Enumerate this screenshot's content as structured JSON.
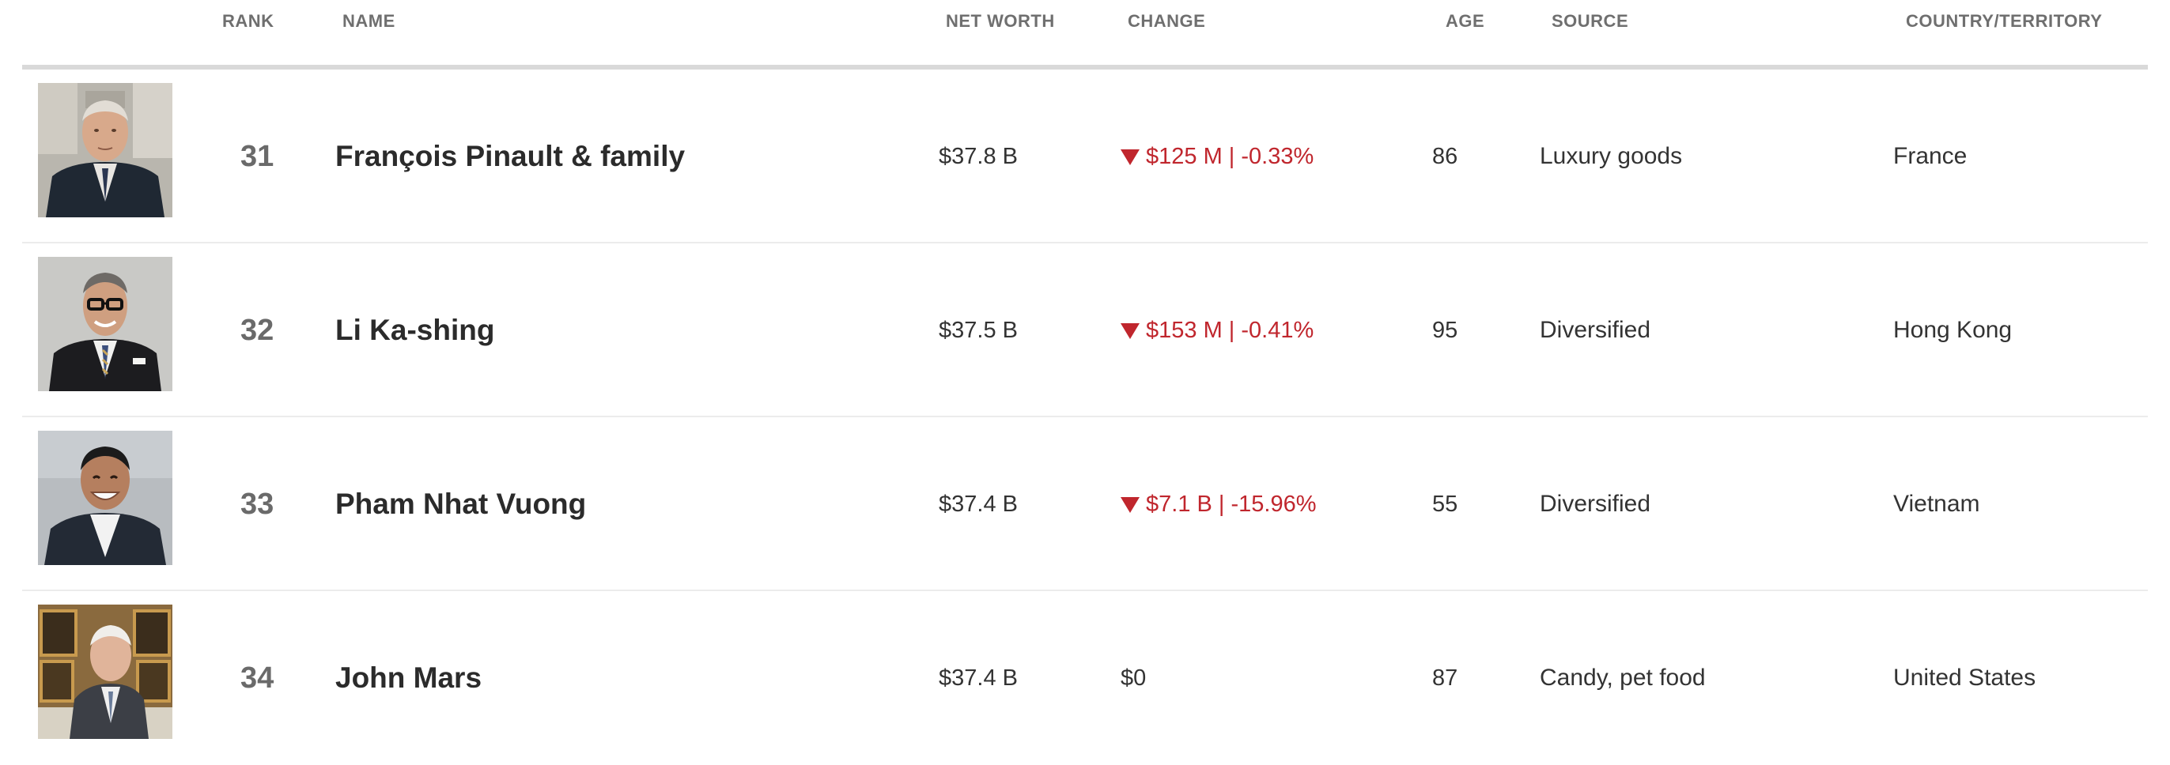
{
  "columns": {
    "rank": "RANK",
    "name": "NAME",
    "net_worth": "NET WORTH",
    "change": "CHANGE",
    "age": "AGE",
    "source": "SOURCE",
    "country": "COUNTRY/TERRITORY"
  },
  "rows": [
    {
      "photo_icon": "person-portrait-photo",
      "rank": "31",
      "name": "François Pinault & family",
      "net_worth": "$37.8 B",
      "change": "$125 M | -0.33%",
      "change_direction": "down",
      "age": "86",
      "source": "Luxury goods",
      "country": "France"
    },
    {
      "photo_icon": "person-portrait-photo",
      "rank": "32",
      "name": "Li Ka-shing",
      "net_worth": "$37.5 B",
      "change": "$153 M | -0.41%",
      "change_direction": "down",
      "age": "95",
      "source": "Diversified",
      "country": "Hong Kong"
    },
    {
      "photo_icon": "person-portrait-photo",
      "rank": "33",
      "name": "Pham Nhat Vuong",
      "net_worth": "$37.4 B",
      "change": "$7.1 B | -15.96%",
      "change_direction": "down",
      "age": "55",
      "source": "Diversified",
      "country": "Vietnam"
    },
    {
      "photo_icon": "person-portrait-photo",
      "rank": "34",
      "name": "John Mars",
      "net_worth": "$37.4 B",
      "change": "$0",
      "change_direction": "none",
      "age": "87",
      "source": "Candy, pet food",
      "country": "United States"
    }
  ],
  "colors": {
    "negative_change": "#c0262d",
    "header_text": "#6f6f6f",
    "rank_text": "#6a6a6a"
  }
}
